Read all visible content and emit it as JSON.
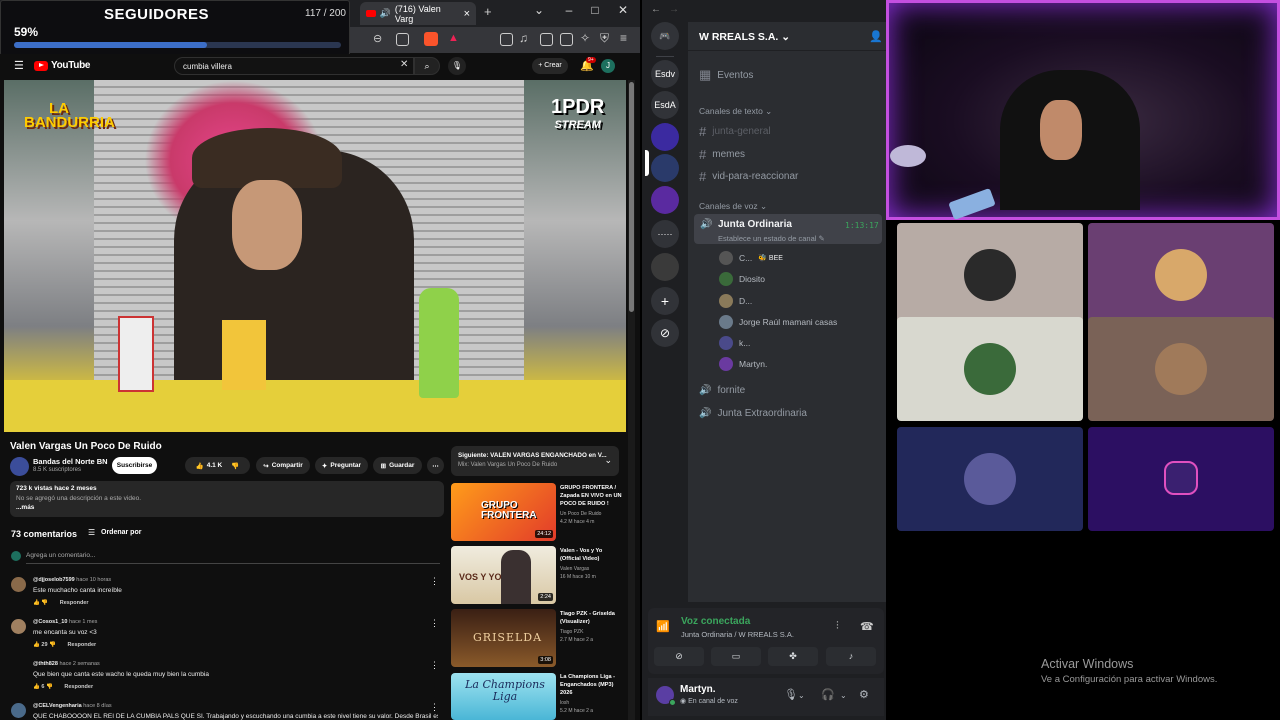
{
  "overlay": {
    "title": "SEGUIDORES",
    "count": "117 / 200",
    "percent": "59%",
    "progress": 0.59
  },
  "browser": {
    "tab_title": "(716) Valen Varg"
  },
  "youtube": {
    "logo": "YouTube",
    "search_value": "cumbia villera",
    "create_label": "+ Crear",
    "notif_count": "9+",
    "avatar_letter": "J",
    "video_overlay_left": "LA BANDURRIA",
    "video_overlay_right": "1PDR",
    "video_overlay_right_sub": "STREAM",
    "video_title": "Valen Vargas Un Poco De Ruido",
    "channel": "Bandas del Norte BN",
    "subs": "8.5 K suscriptores",
    "subscribe": "Suscribirse",
    "likes": "4.1 K",
    "share": "Compartir",
    "ask": "Preguntar",
    "save": "Guardar",
    "desc_stats": "723 k vistas  hace 2 meses",
    "desc_text": "No se agregó una descripción a este video.",
    "desc_more": "...más",
    "comments_count": "73 comentarios",
    "sort": "Ordenar por",
    "add_comment": "Agrega un comentario...",
    "comments": [
      {
        "user": "@djjoselob7599",
        "time": "hace 10 horas",
        "text": "Este muchacho canta increíble",
        "likes": "",
        "reply": "Responder"
      },
      {
        "user": "@Cosos1_10",
        "time": "hace 1 mes",
        "text": "me encanta su voz <3",
        "likes": "29",
        "reply": "Responder"
      },
      {
        "user": "@thth828",
        "time": "hace 2 semanas",
        "text": "Que bien que canta este wacho le queda muy bien la cumbia",
        "likes": "6",
        "reply": "Responder"
      },
      {
        "user": "@CELVengenharia",
        "time": "hace 8 días",
        "text": "QUE CHABOOOON EL REI DE LA CUMBIA PALS QUE SI. Trabajando y escuchando una cumbia a este nivel tiene su valor. Desde Brasil escuchando",
        "likes": "",
        "reply": ""
      }
    ],
    "next_label": "Siguiente: VALEN VARGAS ENGANCHADO en V...",
    "next_sub": "Mix: Valen Vargas Un Poco De Ruido",
    "suggestions": [
      {
        "title": "GRUPO FRONTERA / Zapada EN VIVO en UN POCO DE RUIDO !",
        "channel": "Un Poco De Ruido",
        "meta": "4.2 M  hace 4 m",
        "duration": "24:12",
        "thumb_text": "GRUPO FRONTERA"
      },
      {
        "title": "Valen - Vos y Yo (Official Video)",
        "channel": "Valen Vargas",
        "meta": "16 M  hace 10 m",
        "duration": "2:24",
        "thumb_text": "VOS Y YO"
      },
      {
        "title": "Tiago PZK - Griselda (Visualizer)",
        "channel": "Tiago PZK",
        "meta": "2.7 M  hace 2 a",
        "duration": "3:08",
        "thumb_text": "GRISELDA"
      },
      {
        "title": "La Champions Liga - Enganchados (MP3) 2026",
        "channel": "losh",
        "meta": "5.2 M  hace 2 a",
        "duration": "",
        "thumb_text": "La Champions Liga"
      }
    ]
  },
  "discord": {
    "server_name": "W RREALS S.A.",
    "servers": [
      "Esdv",
      "EsdA"
    ],
    "events": "Eventos",
    "text_category": "Canales de texto",
    "channels": [
      "junta-general",
      "memes",
      "vid-para-reaccionar"
    ],
    "voice_category": "Canales de voz",
    "voice_channel": "Junta Ordinaria",
    "voice_time": "1:13:17",
    "voice_status": "Establece un estado de canal",
    "voice_users": [
      "C...",
      "Diosito",
      "D...",
      "Jorge Raúl mamani casas",
      "k...",
      "Martyn."
    ],
    "voice_user_badge": "BEE",
    "other_voice": [
      "fornite",
      "Junta Extraordinaria"
    ],
    "connected_title": "Voz conectada",
    "connected_sub": "Junta Ordinaria / W RREALS S.A.",
    "username": "Martyn.",
    "user_status": "En canal de voz"
  },
  "windows": {
    "line1": "Activar Windows",
    "line2": "Ve a Configuración para activar Windows."
  },
  "colors": {
    "accent": "#3c6ec7",
    "discord_green": "#3ba55d",
    "yt_red": "#ff0000",
    "webcam_border": "#c44fe0"
  }
}
